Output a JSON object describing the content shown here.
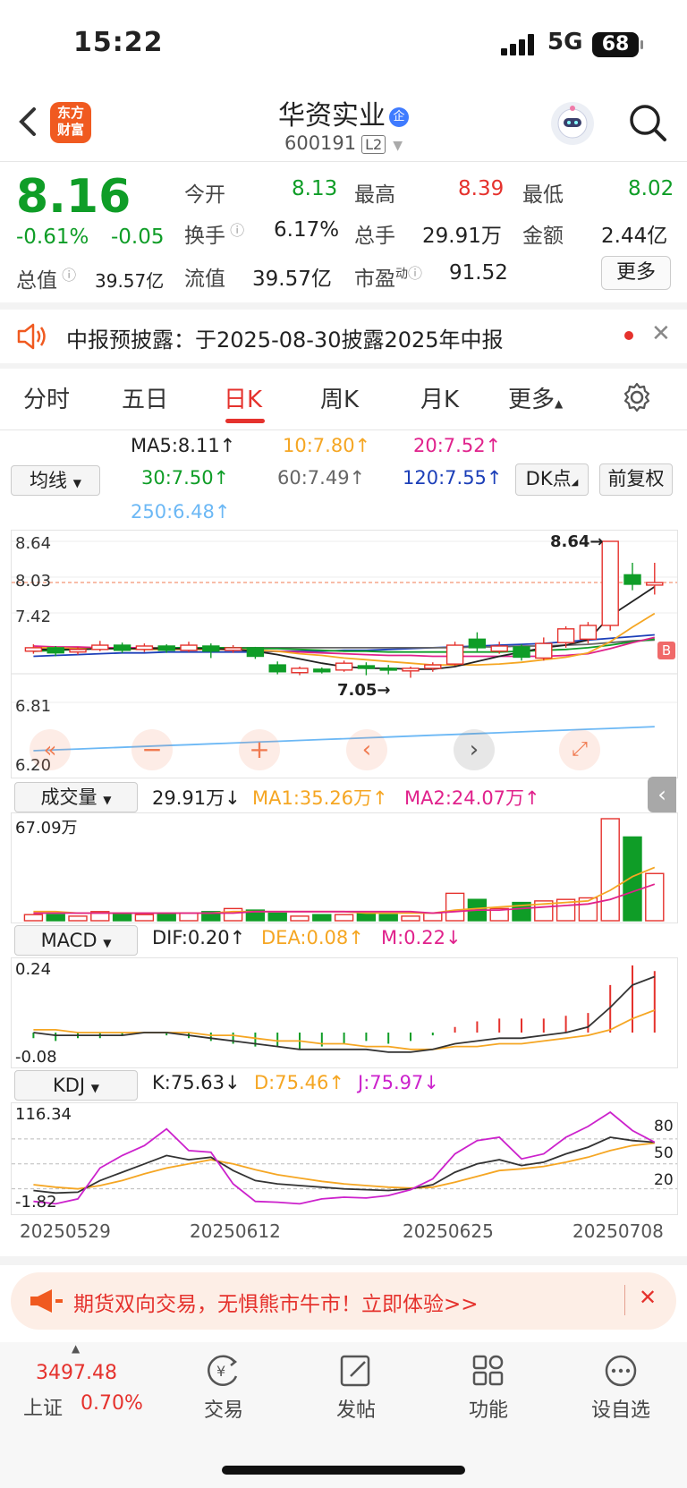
{
  "status": {
    "time": "15:22",
    "network": "5G",
    "battery": "68"
  },
  "header": {
    "back_icon": "chevron-left-icon",
    "logo_line1": "东方",
    "logo_line2": "财富",
    "stock_name": "华资实业",
    "badge": "企",
    "stock_code": "600191",
    "level": "L2"
  },
  "quote": {
    "price": "8.16",
    "change_pct": "-0.61%",
    "change": "-0.05",
    "open_label": "今开",
    "open": "8.13",
    "high_label": "最高",
    "high": "8.39",
    "low_label": "最低",
    "low": "8.02",
    "turnover_label": "换手",
    "turnover": "6.17%",
    "volume_label": "总手",
    "volume": "29.91万",
    "amount_label": "金额",
    "amount": "2.44亿",
    "mktcap_label": "总值",
    "mktcap": "39.57亿",
    "float_label": "流值",
    "float": "39.57亿",
    "pe_label": "市盈",
    "pe_sup": "动",
    "pe": "91.52",
    "more_label": "更多"
  },
  "notice": {
    "text": "中报预披露：于2025-08-30披露2025年中报"
  },
  "tabs": [
    "分时",
    "五日",
    "日K",
    "周K",
    "月K",
    "更多"
  ],
  "ma": {
    "select": "均线",
    "ma5": "MA5:8.11↑",
    "ma10": "10:7.80↑",
    "ma20": "20:7.52↑",
    "ma30": "30:7.50↑",
    "ma60": "60:7.49↑",
    "ma120": "120:7.55↑",
    "ma250": "250:6.48↑",
    "dk": "DK点",
    "adj": "前复权",
    "colors": {
      "ma5": "#222222",
      "ma10": "#f5a623",
      "ma20": "#e0228c",
      "ma30": "#0f9d27",
      "ma60": "#666666",
      "ma120": "#1c3fb8",
      "ma250": "#6cb8f5"
    }
  },
  "kline": {
    "ytop": "8.64",
    "y2": "8.03",
    "y3": "7.42",
    "y4": "6.81",
    "ybottom": "6.20",
    "max_label": "8.64→",
    "min_label": "7.05→",
    "b_label": "B",
    "candles": [
      {
        "o": 7.36,
        "c": 7.4,
        "h": 7.44,
        "l": 7.33
      },
      {
        "o": 7.4,
        "c": 7.34,
        "h": 7.42,
        "l": 7.3
      },
      {
        "o": 7.35,
        "c": 7.38,
        "h": 7.41,
        "l": 7.32
      },
      {
        "o": 7.38,
        "c": 7.43,
        "h": 7.48,
        "l": 7.36
      },
      {
        "o": 7.43,
        "c": 7.37,
        "h": 7.46,
        "l": 7.34
      },
      {
        "o": 7.38,
        "c": 7.42,
        "h": 7.45,
        "l": 7.35
      },
      {
        "o": 7.42,
        "c": 7.37,
        "h": 7.44,
        "l": 7.34
      },
      {
        "o": 7.37,
        "c": 7.43,
        "h": 7.47,
        "l": 7.35
      },
      {
        "o": 7.42,
        "c": 7.36,
        "h": 7.45,
        "l": 7.28
      },
      {
        "o": 7.37,
        "c": 7.4,
        "h": 7.43,
        "l": 7.34
      },
      {
        "o": 7.4,
        "c": 7.3,
        "h": 7.41,
        "l": 7.27
      },
      {
        "o": 7.2,
        "c": 7.12,
        "h": 7.24,
        "l": 7.09
      },
      {
        "o": 7.11,
        "c": 7.16,
        "h": 7.18,
        "l": 7.08
      },
      {
        "o": 7.15,
        "c": 7.12,
        "h": 7.17,
        "l": 7.1
      },
      {
        "o": 7.14,
        "c": 7.22,
        "h": 7.25,
        "l": 7.12
      },
      {
        "o": 7.19,
        "c": 7.16,
        "h": 7.23,
        "l": 7.08
      },
      {
        "o": 7.16,
        "c": 7.14,
        "h": 7.2,
        "l": 7.09
      },
      {
        "o": 7.13,
        "c": 7.16,
        "h": 7.18,
        "l": 7.05
      },
      {
        "o": 7.16,
        "c": 7.2,
        "h": 7.23,
        "l": 7.12
      },
      {
        "o": 7.21,
        "c": 7.43,
        "h": 7.47,
        "l": 7.19
      },
      {
        "o": 7.5,
        "c": 7.4,
        "h": 7.58,
        "l": 7.36
      },
      {
        "o": 7.36,
        "c": 7.42,
        "h": 7.47,
        "l": 7.33
      },
      {
        "o": 7.41,
        "c": 7.29,
        "h": 7.44,
        "l": 7.25
      },
      {
        "o": 7.28,
        "c": 7.45,
        "h": 7.52,
        "l": 7.25
      },
      {
        "o": 7.46,
        "c": 7.62,
        "h": 7.65,
        "l": 7.4
      },
      {
        "o": 7.5,
        "c": 7.66,
        "h": 7.7,
        "l": 7.45
      },
      {
        "o": 7.66,
        "c": 8.64,
        "h": 8.64,
        "l": 7.6
      },
      {
        "o": 8.25,
        "c": 8.14,
        "h": 8.39,
        "l": 8.07
      },
      {
        "o": 8.13,
        "c": 8.16,
        "h": 8.39,
        "l": 8.02
      }
    ],
    "ma5_line": [
      7.38,
      7.38,
      7.38,
      7.39,
      7.39,
      7.39,
      7.39,
      7.39,
      7.39,
      7.38,
      7.36,
      7.32,
      7.27,
      7.22,
      7.18,
      7.16,
      7.16,
      7.15,
      7.15,
      7.18,
      7.24,
      7.3,
      7.35,
      7.4,
      7.43,
      7.49,
      7.77,
      7.94,
      8.11
    ],
    "ma10_line": [
      7.4,
      7.4,
      7.39,
      7.39,
      7.39,
      7.38,
      7.38,
      7.38,
      7.38,
      7.38,
      7.37,
      7.36,
      7.33,
      7.31,
      7.28,
      7.26,
      7.24,
      7.22,
      7.2,
      7.2,
      7.2,
      7.21,
      7.23,
      7.26,
      7.29,
      7.34,
      7.47,
      7.64,
      7.8
    ],
    "ma20_line": [
      7.42,
      7.41,
      7.41,
      7.4,
      7.4,
      7.4,
      7.39,
      7.39,
      7.38,
      7.38,
      7.37,
      7.36,
      7.35,
      7.34,
      7.33,
      7.32,
      7.31,
      7.31,
      7.3,
      7.3,
      7.3,
      7.3,
      7.3,
      7.3,
      7.31,
      7.33,
      7.39,
      7.46,
      7.52
    ],
    "ma30_line": [
      7.36,
      7.37,
      7.38,
      7.39,
      7.39,
      7.4,
      7.4,
      7.4,
      7.4,
      7.4,
      7.39,
      7.39,
      7.38,
      7.37,
      7.36,
      7.36,
      7.35,
      7.35,
      7.35,
      7.35,
      7.35,
      7.35,
      7.36,
      7.37,
      7.38,
      7.4,
      7.43,
      7.47,
      7.5
    ],
    "ma60_line": [
      7.4,
      7.4,
      7.4,
      7.4,
      7.4,
      7.4,
      7.4,
      7.4,
      7.4,
      7.4,
      7.4,
      7.4,
      7.4,
      7.4,
      7.4,
      7.4,
      7.4,
      7.4,
      7.4,
      7.4,
      7.41,
      7.41,
      7.42,
      7.42,
      7.43,
      7.44,
      7.46,
      7.48,
      7.49
    ],
    "ma120_line": [
      7.3,
      7.31,
      7.32,
      7.33,
      7.34,
      7.34,
      7.35,
      7.35,
      7.35,
      7.35,
      7.35,
      7.36,
      7.36,
      7.36,
      7.37,
      7.37,
      7.38,
      7.39,
      7.4,
      7.41,
      7.42,
      7.43,
      7.44,
      7.45,
      7.47,
      7.49,
      7.51,
      7.53,
      7.55
    ],
    "ma250_line": [
      6.2,
      6.21,
      6.22,
      6.23,
      6.24,
      6.25,
      6.26,
      6.27,
      6.28,
      6.29,
      6.3,
      6.31,
      6.32,
      6.33,
      6.34,
      6.35,
      6.36,
      6.37,
      6.38,
      6.39,
      6.4,
      6.41,
      6.42,
      6.43,
      6.44,
      6.45,
      6.46,
      6.47,
      6.48
    ]
  },
  "volume": {
    "select": "成交量",
    "value": "29.91万↓",
    "ma1": "MA1:35.26万↑",
    "ma2": "MA2:24.07万↑",
    "ytop": "67.09万",
    "bars": [
      4,
      4,
      3,
      6,
      5,
      4,
      5,
      5,
      6,
      8,
      7,
      5,
      3,
      4,
      4,
      5,
      4,
      3,
      5,
      18,
      14,
      8,
      12,
      13,
      14,
      15,
      67,
      55,
      31
    ],
    "ma1_line": [
      6,
      6,
      5,
      5,
      5,
      5,
      5,
      5,
      5,
      6,
      6,
      6,
      6,
      6,
      6,
      5,
      5,
      5,
      5,
      7,
      8,
      9,
      10,
      11,
      12,
      13,
      20,
      29,
      35
    ],
    "ma2_line": [
      5,
      5,
      5,
      5,
      5,
      5,
      5,
      5,
      5,
      5,
      6,
      6,
      6,
      6,
      6,
      6,
      6,
      6,
      5,
      6,
      7,
      7,
      8,
      9,
      10,
      11,
      14,
      19,
      24
    ]
  },
  "macd": {
    "select": "MACD",
    "dif": "DIF:0.20↑",
    "dea": "DEA:0.08↑",
    "m": "M:0.22↓",
    "ytop": "0.24",
    "ybottom": "-0.08",
    "dif_line": [
      0.0,
      -0.01,
      -0.01,
      -0.01,
      -0.01,
      0.0,
      0.0,
      -0.01,
      -0.02,
      -0.03,
      -0.04,
      -0.05,
      -0.06,
      -0.06,
      -0.06,
      -0.06,
      -0.07,
      -0.07,
      -0.06,
      -0.04,
      -0.03,
      -0.02,
      -0.02,
      -0.01,
      0.0,
      0.02,
      0.09,
      0.17,
      0.2
    ],
    "dea_line": [
      0.01,
      0.01,
      0.0,
      0.0,
      0.0,
      0.0,
      0.0,
      0.0,
      -0.01,
      -0.01,
      -0.02,
      -0.03,
      -0.03,
      -0.04,
      -0.04,
      -0.05,
      -0.05,
      -0.06,
      -0.06,
      -0.05,
      -0.05,
      -0.04,
      -0.04,
      -0.03,
      -0.02,
      -0.01,
      0.01,
      0.05,
      0.08
    ],
    "m_bars": [
      -0.02,
      -0.03,
      -0.02,
      -0.02,
      -0.01,
      0.0,
      -0.01,
      -0.02,
      -0.03,
      -0.04,
      -0.05,
      -0.05,
      -0.06,
      -0.05,
      -0.04,
      -0.03,
      -0.04,
      -0.03,
      -0.01,
      0.02,
      0.04,
      0.05,
      0.05,
      0.05,
      0.06,
      0.07,
      0.17,
      0.24,
      0.22
    ]
  },
  "kdj": {
    "select": "KDJ",
    "k": "K:75.63↓",
    "d": "D:75.46↑",
    "j": "J:75.97↓",
    "ytop": "116.34",
    "ybottom": "-1.82",
    "r80": "80",
    "r50": "50",
    "r20": "20",
    "k_line": [
      18,
      15,
      16,
      30,
      40,
      50,
      60,
      55,
      58,
      42,
      30,
      26,
      24,
      22,
      20,
      19,
      18,
      20,
      25,
      40,
      50,
      55,
      48,
      52,
      62,
      70,
      82,
      78,
      76
    ],
    "d_line": [
      25,
      22,
      20,
      24,
      30,
      38,
      45,
      50,
      55,
      50,
      43,
      37,
      33,
      29,
      26,
      24,
      22,
      21,
      22,
      28,
      35,
      42,
      44,
      47,
      52,
      58,
      66,
      72,
      75
    ],
    "j_line": [
      5,
      2,
      8,
      45,
      60,
      72,
      92,
      66,
      64,
      26,
      5,
      4,
      2,
      8,
      10,
      9,
      12,
      19,
      32,
      62,
      78,
      82,
      56,
      62,
      82,
      95,
      112,
      90,
      76
    ]
  },
  "dates": [
    "20250529",
    "20250612",
    "20250625",
    "20250708"
  ],
  "banner": {
    "text": "期货双向交易，无惧熊市牛市！立即体验>>"
  },
  "bottom_nav": {
    "index_value": "3497.48",
    "index_name": "上证",
    "index_change": "0.70%",
    "trade": "交易",
    "post": "发帖",
    "func": "功能",
    "watch": "设自选"
  }
}
